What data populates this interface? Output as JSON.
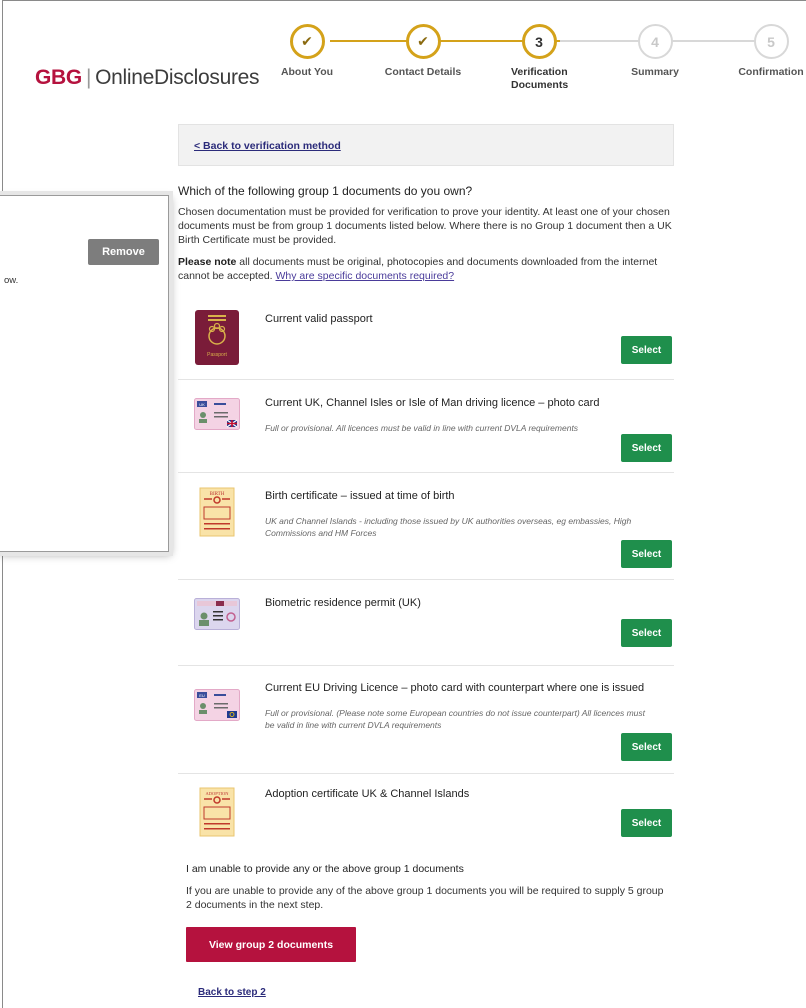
{
  "logo": {
    "brand": "GBG",
    "product": "OnlineDisclosures"
  },
  "stepper": {
    "steps": [
      {
        "number": "✔",
        "label": "About You",
        "state": "done"
      },
      {
        "number": "✔",
        "label": "Contact Details",
        "state": "done"
      },
      {
        "number": "3",
        "label": "Verification Documents",
        "state": "current"
      },
      {
        "number": "4",
        "label": "Summary",
        "state": "todo"
      },
      {
        "number": "5",
        "label": "Confirmation",
        "state": "todo"
      }
    ]
  },
  "popup": {
    "remove_label": "Remove",
    "fragment_text": "ow."
  },
  "back_link": "< Back to verification method",
  "question": "Which of the following group 1 documents do you own?",
  "intro": "Chosen documentation must be provided for verification to prove your identity. At least one of your chosen documents must be from group 1 documents listed below. Where there is no Group 1 document then a UK Birth Certificate must be provided.",
  "note": {
    "bold": "Please note",
    "text": " all documents must be original, photocopies and documents downloaded from the internet cannot be accepted. ",
    "link": "Why are specific documents required?"
  },
  "documents": [
    {
      "title": "Current valid passport",
      "desc": "",
      "select_label": "Select",
      "icon": "passport-icon"
    },
    {
      "title": "Current UK, Channel Isles or Isle of Man driving licence – photo card",
      "desc": "Full or provisional. All licences must be valid in line with current DVLA requirements",
      "select_label": "Select",
      "icon": "uk-licence-icon",
      "badge": "UK"
    },
    {
      "title": "Birth certificate – issued at time of birth",
      "desc": "UK and Channel Islands - including those issued by UK authorities overseas, eg embassies, High Commissions and HM Forces",
      "select_label": "Select",
      "icon": "birth-certificate-icon",
      "badge": "BIRTH"
    },
    {
      "title": "Biometric residence permit (UK)",
      "desc": "",
      "select_label": "Select",
      "icon": "residence-permit-icon"
    },
    {
      "title": "Current EU Driving Licence – photo card with counterpart where one is issued",
      "desc": "Full or provisional. (Please note some European countries do not issue counterpart) All licences must be valid in line with current DVLA requirements",
      "select_label": "Select",
      "icon": "eu-licence-icon",
      "badge": "EU"
    },
    {
      "title": "Adoption certificate UK & Channel Islands",
      "desc": "",
      "select_label": "Select",
      "icon": "adoption-certificate-icon",
      "badge": "ADOPTION"
    }
  ],
  "none_title": "I am unable to provide any or the above group 1 documents",
  "none_desc": "If you are unable to provide any of the above group 1 documents you will be required to supply 5 group 2 documents in the next step.",
  "group2_button": "View group 2 documents",
  "back_step": "Back to step 2",
  "colors": {
    "brand": "#b5123e",
    "gold": "#d4a21a",
    "select": "#1f8f4c",
    "link": "#2b2b7a"
  }
}
